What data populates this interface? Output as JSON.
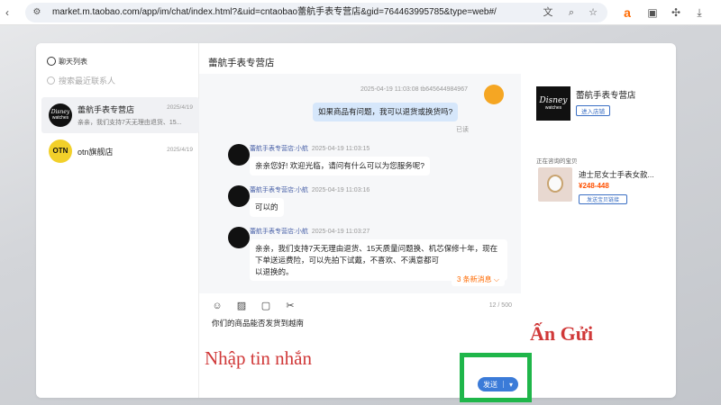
{
  "browser": {
    "url": "market.m.taobao.com/app/im/chat/index.html?&uid=cntaobao蕾航手表专营店&gid=764463995785&type=web#/",
    "extension_label": "a"
  },
  "sidebar": {
    "title": "聊天列表",
    "search_placeholder": "搜索最近联系人",
    "contacts": [
      {
        "name": "蕾航手表专营店",
        "date": "2025/4/19",
        "preview": "亲亲，我们支持7天无理由退货、15..."
      },
      {
        "name": "otn旗舰店",
        "date": "2025/4/19",
        "preview": ""
      }
    ]
  },
  "chat": {
    "title": "蕾航手表专营店",
    "messages": [
      {
        "meta": "2025-04-19 11:03:08   tb645644984967",
        "text": "如果商品有问题，我可以退货或换货吗?",
        "status": "已读"
      },
      {
        "sender": "蕾航手表专营店:小航",
        "time": "2025-04-19 11:03:15",
        "text": "亲亲您好! 欢迎光临，请问有什么可以为您服务呢?"
      },
      {
        "sender": "蕾航手表专营店:小航",
        "time": "2025-04-19 11:03:16",
        "text": "可以的"
      },
      {
        "sender": "蕾航手表专营店:小航",
        "time": "2025-04-19 11:03:27",
        "text_lines": [
          "亲亲，我们支持7天无理由退货、15天质量问题换、机芯保修十年，现在下单送运费险，可以先拍下试戴，不喜欢、不满意都可",
          "以退换的。"
        ]
      }
    ],
    "more_messages": "3 条新消息 ⌵"
  },
  "composer": {
    "char_count": "12 / 500",
    "draft": "你们的商品能否发货到越南",
    "send_label": "发送"
  },
  "product_panel": {
    "shop_name": "蕾航手表专营店",
    "shop_logo_brand": "Disney",
    "shop_logo_sub": "watches",
    "enter_shop": "进入店铺",
    "inquiry_label": "正在咨询的宝贝",
    "product_name": "迪士尼女士手表女款...",
    "product_price": "¥248-448",
    "send_link": "发送宝贝链接"
  },
  "annotations": {
    "input_hint": "Nhập tin nhắn",
    "send_hint": "Ấn Gửi"
  },
  "colors": {
    "send_button": "#3b7bd8",
    "annotation_red": "#d03838",
    "highlight_green": "#1fb64a",
    "price_orange": "#ff5000"
  }
}
